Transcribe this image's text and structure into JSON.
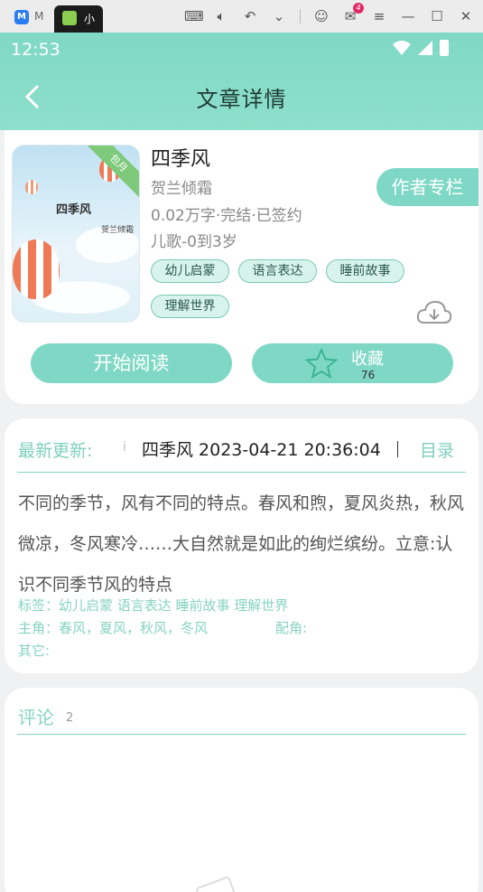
{
  "emulator": {
    "tab1_label": "M",
    "tab2_label": "小",
    "mail_badge": "4"
  },
  "status_bar": {
    "time": "12:53"
  },
  "header": {
    "title": "文章详情"
  },
  "book": {
    "cover_badge": "包月",
    "cover_title": "四季风",
    "cover_author": "贺兰倾霜",
    "title": "四季风",
    "author": "贺兰倾霜",
    "meta": "0.02万字·完结·已签约",
    "category": "儿歌-0到3岁",
    "tags": [
      "幼儿启蒙",
      "语言表达",
      "睡前故事",
      "理解世界"
    ],
    "author_column_label": "作者专栏",
    "read_label": "开始阅读",
    "favorite_label": "收藏",
    "favorite_count": "76"
  },
  "update": {
    "label": "最新更新:",
    "text": "四季风  2023-04-21 20:36:04",
    "toc_label": "目录"
  },
  "summary": "不同的季节，风有不同的特点。春风和煦，夏风炎热，秋风微凉，冬风寒冷……大自然就是如此的绚烂缤纷。立意:认识不同季节风的特点",
  "details": {
    "tags_line": "标签：幼儿启蒙  语言表达  睡前故事  理解世界",
    "main_chars": "主角：春风，夏风，秋风，冬风",
    "supporting_label": "配角:",
    "other_label": "其它:"
  },
  "comments": {
    "label": "评论",
    "count": "2"
  },
  "colors": {
    "accent": "#7fd8c5",
    "accent_text": "#7fcfbd"
  },
  "icons": [
    "back-arrow-icon",
    "wifi-icon",
    "signal-icon",
    "battery-icon",
    "download-cloud-icon",
    "star-icon"
  ]
}
